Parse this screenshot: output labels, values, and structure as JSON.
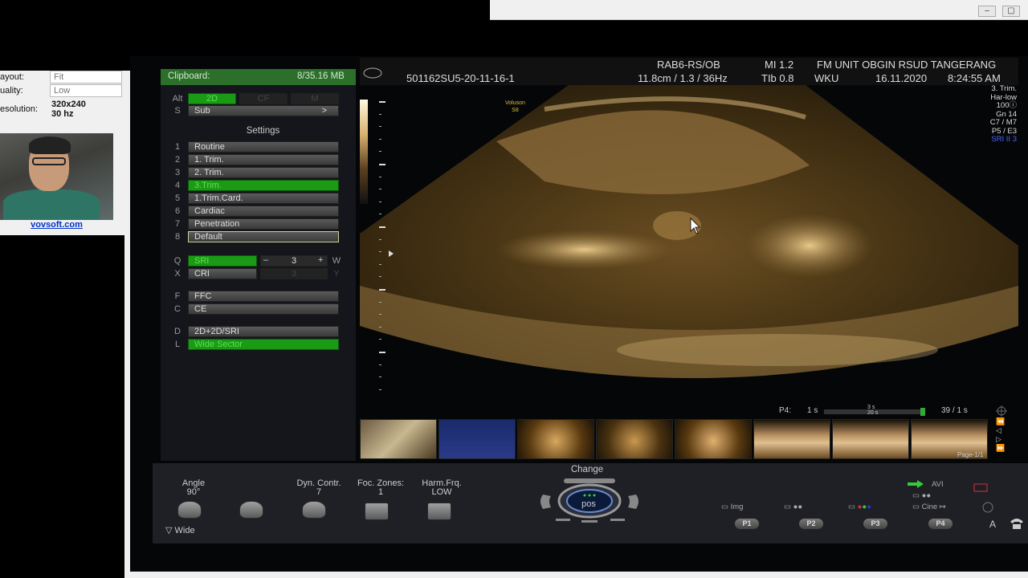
{
  "recorder": {
    "layout_label": "ayout:",
    "layout_value": "Fit",
    "quality_label": "uality:",
    "quality_value": "Low",
    "resolution_label": "esolution:",
    "resolution_value": "320x240 30 hz",
    "link": "vovsoft.com"
  },
  "window_controls": {
    "minimize": "–",
    "maximize": "▢"
  },
  "header": {
    "probe": "RAB6-RS/OB",
    "mi": "MI  1.2",
    "site": "FM UNIT OBGIN RSUD TANGERANG",
    "patient_id": "501162SU5-20-11-16-1",
    "depth": "11.8cm / 1.3 / 36Hz",
    "tib": "TIb  0.8",
    "operator": "WKU",
    "date": "16.11.2020",
    "time": "8:24:55 AM"
  },
  "left_panel": {
    "clipboard_label": "Clipboard:",
    "clipboard_value": "8/35.16 MB",
    "alt_key": "Alt",
    "s_key": "S",
    "mode_2d": "2D",
    "mode_cf": "CF",
    "mode_m": "M",
    "sub_label": "Sub",
    "sub_arrow": ">",
    "settings_title": "Settings",
    "presets": [
      {
        "key": "1",
        "label": "Routine"
      },
      {
        "key": "2",
        "label": "1. Trim."
      },
      {
        "key": "3",
        "label": "2. Trim."
      },
      {
        "key": "4",
        "label": "3.Trim."
      },
      {
        "key": "5",
        "label": "1.Trim.Card."
      },
      {
        "key": "6",
        "label": "Cardiac"
      },
      {
        "key": "7",
        "label": "Penetration"
      },
      {
        "key": "8",
        "label": "Default"
      }
    ],
    "q_key": "Q",
    "sri_label": "SRI",
    "sri_value": "3",
    "w_key": "W",
    "x_key": "X",
    "cri_label": "CRI",
    "cri_value": "3",
    "y_key": "Y",
    "f_key": "F",
    "ffc_label": "FFC",
    "c_key": "C",
    "ce_label": "CE",
    "d_key": "D",
    "mode_2d_sri": "2D+2D/SRI",
    "l_key": "L",
    "wide_sector": "Wide Sector",
    "minus": "–",
    "plus": "+"
  },
  "image": {
    "vol_line1": "Voluson",
    "vol_line2": "S8",
    "params": [
      "3. Trim.",
      "Har-low",
      "100ⓘ",
      "Gn  14",
      "C7 / M7",
      "P5 / E3",
      "SRI II 3"
    ],
    "param_highlight_color": "#5566ff"
  },
  "cine": {
    "p4_label": "P4:",
    "start": "1 s",
    "mid_top": "3 s",
    "mid_bottom": "20 s",
    "end": "39 / 1 s",
    "page": "Page-1/1"
  },
  "console": {
    "angle_label": "Angle",
    "angle_value": "90°",
    "wide_label": "Wide",
    "dyn_label": "Dyn. Contr.",
    "dyn_value": "7",
    "foc_label": "Foc. Zones:",
    "foc_value": "1",
    "harm_label": "Harm.Frq.",
    "harm_value": "LOW",
    "change_label": "Change",
    "pos_label": "pos",
    "avi_label": "AVI",
    "img_label": "Img",
    "cine_label": "Cine ↦",
    "p1": "P1",
    "p2": "P2",
    "p3": "P3",
    "p4": "P4",
    "a_label": "A"
  },
  "colors": {
    "active_green": "#1b9a16",
    "clipboard_green": "#2c6f2a",
    "image_tint": "#b8904a"
  }
}
